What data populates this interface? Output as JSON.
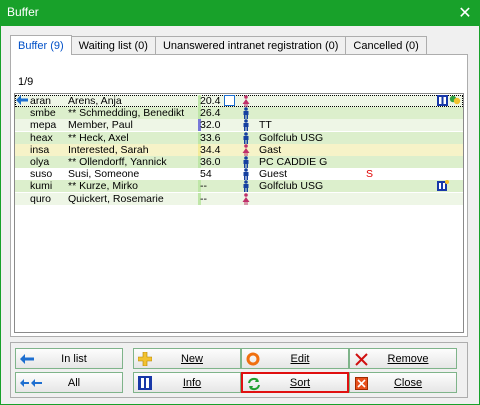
{
  "window": {
    "title": "Buffer",
    "close_glyph": "✕"
  },
  "tabs": [
    {
      "label": "Buffer (9)",
      "active": true
    },
    {
      "label": "Waiting list (0)",
      "active": false
    },
    {
      "label": "Unanswered intranet registration (0)",
      "active": false
    },
    {
      "label": "Cancelled (0)",
      "active": false
    }
  ],
  "counter": "1/9",
  "rows": [
    {
      "code": "aran",
      "name": "Arens, Anja",
      "hcp": "20.4",
      "sex": "female",
      "club": "",
      "mark": "",
      "bg": "#eef6e6"
    },
    {
      "code": "smbe",
      "name": "** Schmedding, Benedikt",
      "hcp": "26.4",
      "sex": "male",
      "club": "",
      "mark": "",
      "bg": "#dcefcc"
    },
    {
      "code": "mepa",
      "name": "Member, Paul",
      "hcp": "32.0",
      "sex": "male",
      "club": "TT",
      "mark": "",
      "bg": "#eef6e6"
    },
    {
      "code": "heax",
      "name": "** Heck, Axel",
      "hcp": "33.6",
      "sex": "male",
      "club": "Golfclub USG",
      "mark": "",
      "bg": "#dcefcc"
    },
    {
      "code": "insa",
      "name": "Interested, Sarah",
      "hcp": "34.4",
      "sex": "female",
      "club": "Gast",
      "mark": "",
      "bg": "#f6f3c8"
    },
    {
      "code": "olya",
      "name": "** Ollendorff, Yannick",
      "hcp": "36.0",
      "sex": "male",
      "club": "PC CADDIE G",
      "mark": "",
      "bg": "#dcefcc"
    },
    {
      "code": "suso",
      "name": "Susi, Someone",
      "hcp": "54",
      "sex": "male",
      "club": "Guest",
      "mark": "S",
      "bg": "#ffffff"
    },
    {
      "code": "kumi",
      "name": "** Kurze, Mirko",
      "hcp": "--",
      "sex": "male",
      "club": "Golfclub USG",
      "mark": "",
      "bg": "#dcefcc"
    },
    {
      "code": "quro",
      "name": "Quickert, Rosemarie",
      "hcp": "--",
      "sex": "female",
      "club": "",
      "mark": "",
      "bg": "#eef6e6"
    }
  ],
  "buttons": {
    "in_list": "In list",
    "new": "New",
    "edit": "Edit",
    "remove": "Remove",
    "all": "All",
    "info": "Info",
    "sort": "Sort",
    "close": "Close"
  },
  "colors": {
    "titlebar": "#18a12a",
    "male": "#1540a0",
    "female": "#c0306a",
    "focus": "#e01010"
  }
}
